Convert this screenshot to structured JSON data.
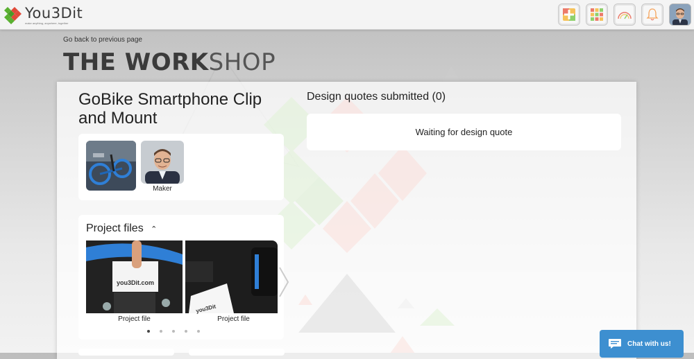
{
  "header": {
    "logo_name": "You3Dit",
    "logo_tagline": "make anything, anywhere, together",
    "icons": [
      "add-project-icon",
      "grid-icon",
      "gauge-icon",
      "bell-icon",
      "avatar"
    ]
  },
  "nav": {
    "back_label": "Go back to previous page"
  },
  "workshop": {
    "title_bold": "THE WORK",
    "title_light": "SHOP"
  },
  "project": {
    "title": "GoBike Smartphone Clip and Mount",
    "maker_label": "Maker",
    "files_heading": "Project files",
    "files": [
      {
        "label": "Project file",
        "card_text": "you3Dit.com"
      },
      {
        "label": "Project file",
        "card_text": "you3Dit"
      }
    ],
    "carousel_total": 5,
    "carousel_active": 1
  },
  "quotes": {
    "heading": "Design quotes submitted (0)",
    "waiting": "Waiting for design quote"
  },
  "chat": {
    "label": "Chat with us!"
  },
  "colors": {
    "chat_blue": "#3d8fd0",
    "logo_green": "#5ab031",
    "logo_red": "#e04a3a"
  }
}
